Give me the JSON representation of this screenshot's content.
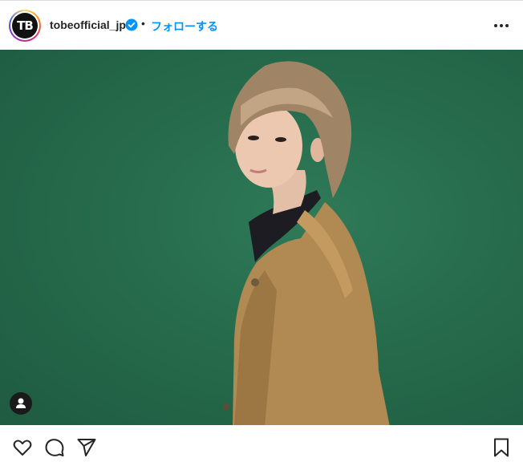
{
  "post": {
    "username": "tobeofficial_jp",
    "follow_label": "フォローする",
    "separator": "•",
    "avatar_text": "TB",
    "verified": true
  },
  "icons": {
    "more": "more-options-icon",
    "tag": "user-tag-icon",
    "like": "heart-icon",
    "comment": "comment-icon",
    "share": "share-icon",
    "save": "bookmark-icon"
  },
  "colors": {
    "link": "#0095f6",
    "background_green": "#266b4c",
    "jacket": "#b08a52"
  }
}
